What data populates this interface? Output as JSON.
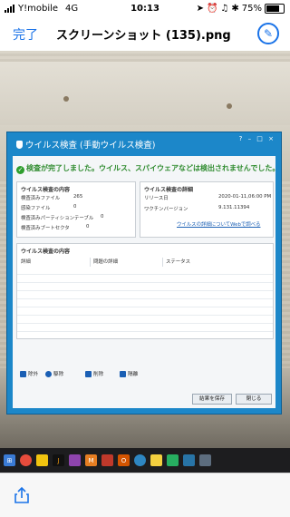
{
  "status_bar": {
    "carrier": "Y!mobile",
    "network": "4G",
    "time": "10:13",
    "battery": "75%",
    "battery_level": 0.75
  },
  "nav": {
    "done_label": "完了",
    "title": "スクリーンショット (135).png",
    "markup_icon": "markup-pen-icon"
  },
  "dialog": {
    "title": "ウイルス検査 (手動ウイルス検査)",
    "window_controls": "? – □ ×",
    "banner": "検査が完了しました。ウイルス、スパイウェアなどは検出されませんでした。",
    "scan_contents": {
      "heading": "ウイルス検査の内容",
      "rows": [
        {
          "label": "検査済みファイル",
          "value": "265"
        },
        {
          "label": "感染ファイル",
          "value": "0"
        },
        {
          "label": "検査済みパーティションテーブル",
          "value": "0"
        },
        {
          "label": "検査済みブートセクタ",
          "value": "0"
        }
      ]
    },
    "scan_details": {
      "heading": "ウイルス検査の詳細",
      "rows": [
        {
          "label": "リリース日",
          "value": "2020-01-11,06:00 PM"
        },
        {
          "label": "ワクチンバージョン",
          "value": "9.131.11394"
        }
      ],
      "link": "ウイルスの詳細についてWebで調べる"
    },
    "results": {
      "heading": "ウイルス検査の内容",
      "columns": [
        "詳細",
        "問題の詳細",
        "ステータス"
      ]
    },
    "actions": [
      "除外",
      "駆除",
      "削除",
      "隔離"
    ],
    "buttons": {
      "save": "結果を保存",
      "close": "閉じる"
    }
  },
  "taskbar_icons": [
    "windows-icon",
    "chrome-icon",
    "files-icon",
    "java-icon",
    "app-icon",
    "outlook-icon",
    "record-icon",
    "office-icon",
    "edge-icon",
    "folder-icon",
    "app-icon",
    "shield-icon",
    "app-icon"
  ],
  "toolbar": {
    "share_icon": "share-icon"
  }
}
